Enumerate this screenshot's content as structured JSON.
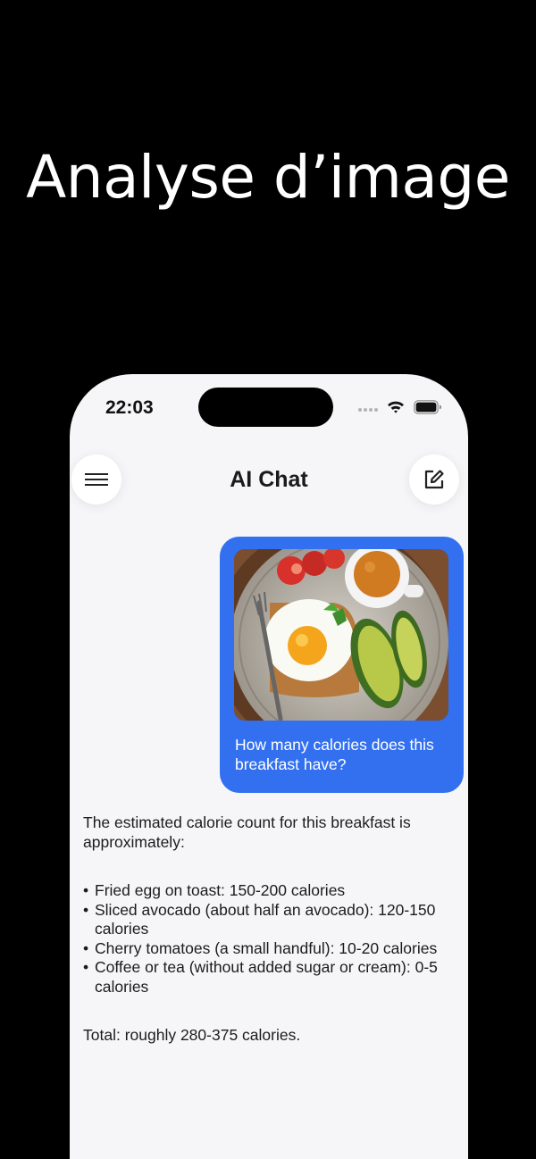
{
  "promo": {
    "headline": "Analyse d’image"
  },
  "status_bar": {
    "time": "22:03"
  },
  "header": {
    "title": "AI Chat"
  },
  "icons": {
    "menu": "hamburger-menu-icon",
    "compose": "compose-icon",
    "wifi": "wifi-icon",
    "battery": "battery-icon"
  },
  "colors": {
    "user_bubble": "#3370f0",
    "background": "#f6f6f8"
  },
  "conversation": {
    "user_message": {
      "image": "breakfast-photo",
      "text": "How many calories does this breakfast have?"
    },
    "ai_message": {
      "intro": "The estimated calorie count for this breakfast is approximately:",
      "items": [
        "Fried egg on toast: 150-200 calories",
        "Sliced avocado (about half an avocado): 120-150 calories",
        "Cherry tomatoes (a small handful): 10-20 calories",
        "Coffee or tea (without added sugar or cream): 0-5 calories"
      ],
      "total": "Total: roughly 280-375 calories."
    }
  }
}
